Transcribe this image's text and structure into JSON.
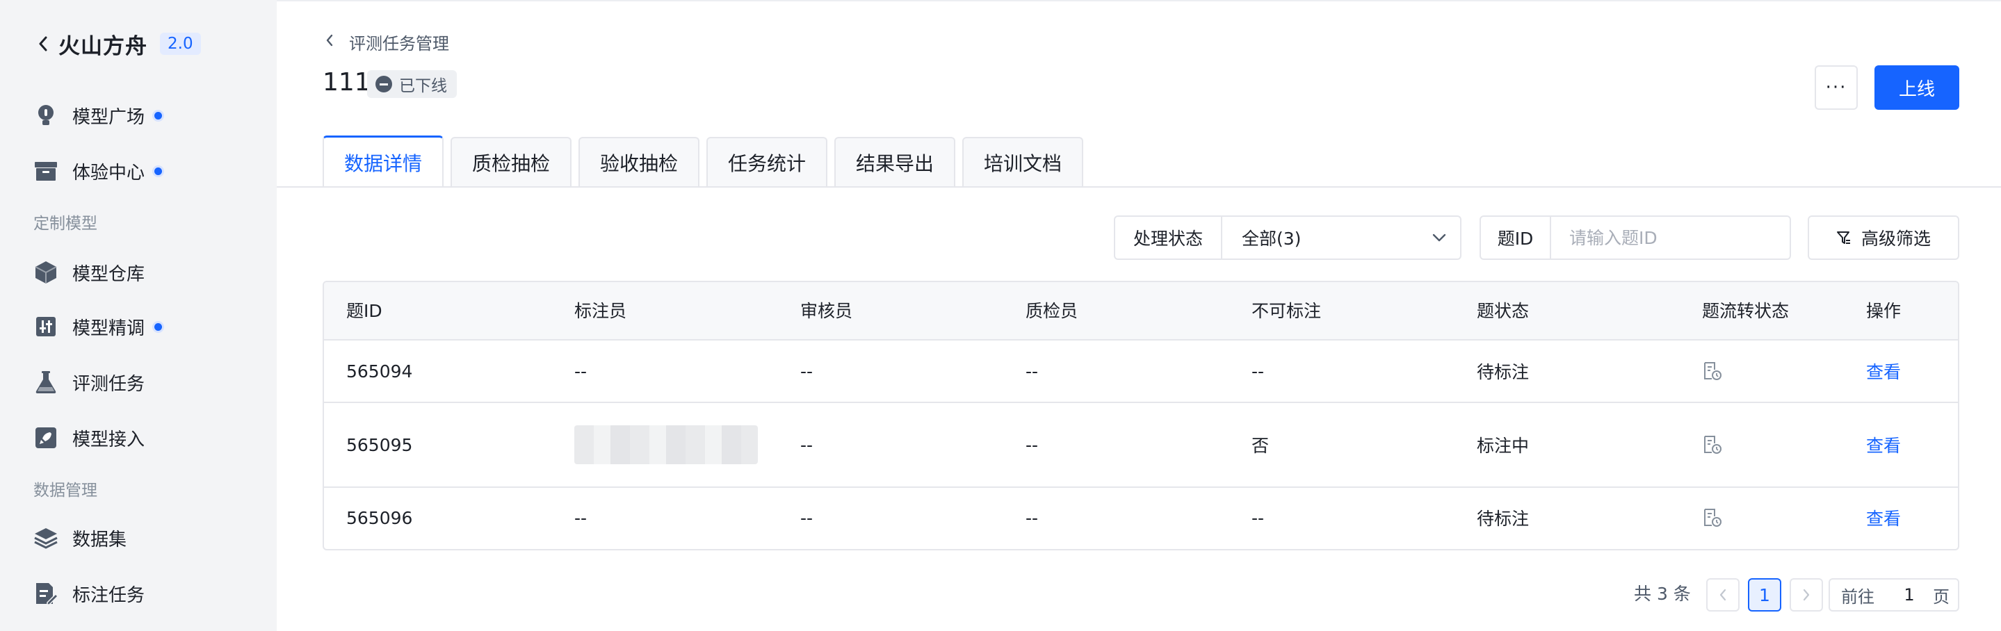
{
  "brand": {
    "title": "火山方舟",
    "version": "2.0"
  },
  "sidebar": {
    "items": [
      {
        "label": "模型广场",
        "icon": "bulb-icon",
        "dot": true
      },
      {
        "label": "体验中心",
        "icon": "archive-box-icon",
        "dot": true
      },
      {
        "group": "定制模型"
      },
      {
        "label": "模型仓库",
        "icon": "cube-icon",
        "dot": false
      },
      {
        "label": "模型精调",
        "icon": "tuning-sliders-icon",
        "dot": true
      },
      {
        "label": "评测任务",
        "icon": "flask-icon",
        "dot": false
      },
      {
        "label": "模型接入",
        "icon": "rocket-icon",
        "dot": false
      },
      {
        "group": "数据管理"
      },
      {
        "label": "数据集",
        "icon": "layers-icon",
        "dot": false
      },
      {
        "label": "标注任务",
        "icon": "edit-document-icon",
        "dot": false
      }
    ]
  },
  "header": {
    "breadcrumb": "评测任务管理",
    "task_title": "111",
    "status": "已下线",
    "more_label": "···",
    "primary_label": "上线"
  },
  "tabs": [
    {
      "label": "数据详情",
      "active": true
    },
    {
      "label": "质检抽检",
      "active": false
    },
    {
      "label": "验收抽检",
      "active": false
    },
    {
      "label": "任务统计",
      "active": false
    },
    {
      "label": "结果导出",
      "active": false
    },
    {
      "label": "培训文档",
      "active": false
    }
  ],
  "filters": {
    "state_label": "处理状态",
    "state_value": "全部(3)",
    "id_label": "题ID",
    "id_placeholder": "请输入题ID",
    "advanced_label": "高级筛选"
  },
  "table": {
    "columns": [
      "题ID",
      "标注员",
      "审核员",
      "质检员",
      "不可标注",
      "题状态",
      "题流转状态",
      "操作"
    ],
    "rows": [
      {
        "id": "565094",
        "annotator": "--",
        "reviewer": "--",
        "inspector": "--",
        "unlabelable": "--",
        "status": "待标注",
        "action": "查看"
      },
      {
        "id": "565095",
        "annotator": "",
        "reviewer": "--",
        "inspector": "--",
        "unlabelable": "否",
        "status": "标注中",
        "action": "查看"
      },
      {
        "id": "565096",
        "annotator": "--",
        "reviewer": "--",
        "inspector": "--",
        "unlabelable": "--",
        "status": "待标注",
        "action": "查看"
      }
    ]
  },
  "pagination": {
    "total": "共 3 条",
    "current": "1",
    "goto_prefix": "前往",
    "goto_value": "1",
    "goto_suffix": "页"
  },
  "colors": {
    "accent": "#1664ff",
    "sidebar_bg": "#f3f4f6"
  }
}
